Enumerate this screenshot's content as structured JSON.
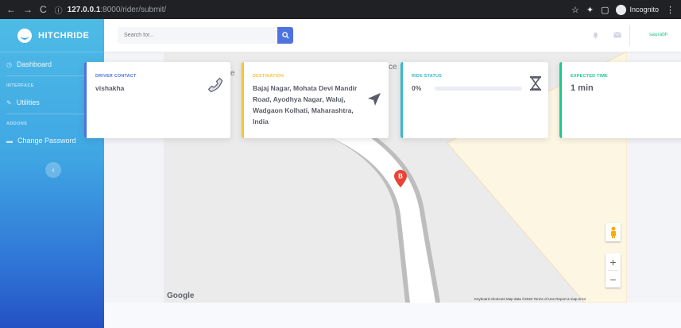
{
  "browser": {
    "url_host": "127.0.0.1",
    "url_path": ":8000/rider/submit/",
    "incognito_label": "Incognito"
  },
  "sidebar": {
    "brand": "HITCHRIDE",
    "dashboard_label": "Dashboard",
    "heading_interface": "INTERFACE",
    "utilities_label": "Utilities",
    "heading_addons": "ADDONS",
    "change_password_label": "Change Password"
  },
  "topbar": {
    "search_placeholder": "Search for...",
    "username": "saurabh"
  },
  "cards": {
    "driver_contact": {
      "label": "DRIVER CONTACT",
      "value": "vishakha",
      "color": "#4e73df",
      "icon": "phone-icon"
    },
    "destination": {
      "label": "DESTINATION",
      "value": "Bajaj Nagar, Mohata Devi Mandir Road, Ayodhya Nagar, Waluj, Wadgaon Kolhati, Maharashtra, India",
      "color": "#f6c23e",
      "icon": "location-arrow-icon"
    },
    "ride_status": {
      "label": "RIDE STATUS",
      "value": "0%",
      "progress": 0,
      "color": "#36b9cc",
      "icon": "hourglass-icon"
    },
    "expected_time": {
      "label": "EXPECTED TIME",
      "value": "1 min",
      "color": "#1cc88a"
    }
  },
  "map": {
    "marker_label": "B",
    "logo": "Google",
    "attribution": "Keyboard shortcuts   Map data ©2022   Terms of Use   Report a map error",
    "zoom_in": "+",
    "zoom_out": "−"
  },
  "colors": {
    "primary": "#4e73df",
    "success": "#1cc88a",
    "info": "#36b9cc",
    "warning": "#f6c23e",
    "marker": "#ea4335"
  }
}
